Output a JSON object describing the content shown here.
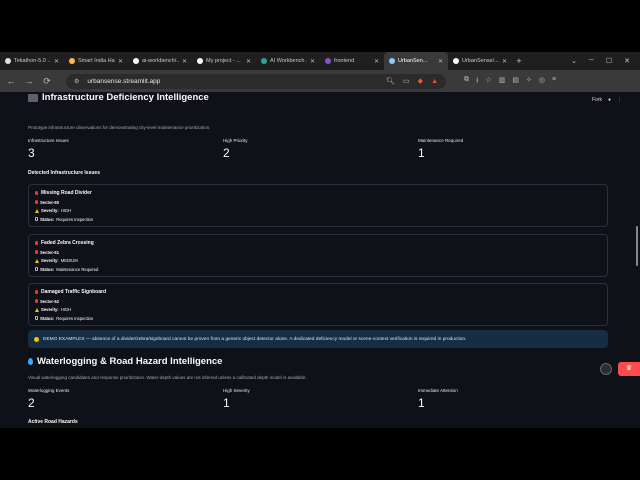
{
  "tabs": [
    {
      "label": "Tekathon-5.0 ..",
      "color": "#e0e0e0",
      "active": false
    },
    {
      "label": "Smart India Ha...",
      "color": "#ffb74d",
      "active": false
    },
    {
      "label": "ai-workbench/...",
      "color": "#ffffff",
      "active": false
    },
    {
      "label": "My project - ...",
      "color": "#ffffff",
      "active": false
    },
    {
      "label": "AI Workbench ...",
      "color": "#26a69a",
      "active": false
    },
    {
      "label": "frontend",
      "color": "#7e57c2",
      "active": false
    },
    {
      "label": "UrbanSen...",
      "color": "#90caf9",
      "active": true
    },
    {
      "label": "UrbanSense/...",
      "color": "#ffffff",
      "active": false
    }
  ],
  "browser": {
    "url": "urbansense.streamlit.app",
    "new_tab": "+",
    "back": "←",
    "forward": "→",
    "reload": "⟳",
    "min": "─",
    "max": "☐",
    "close": "✕",
    "dropdown": "⌄"
  },
  "header": {
    "fork_label": "Fork"
  },
  "infra": {
    "title": "Infrastructure Deficiency Intelligence",
    "subtitle": "Prototype infrastructure observations for demonstrating city-level maintenance prioritization.",
    "metrics": [
      {
        "label": "Infrastructure Issues",
        "value": "3"
      },
      {
        "label": "High Priority",
        "value": "2"
      },
      {
        "label": "Maintenance Required",
        "value": "1"
      }
    ],
    "detected_label": "Detected Infrastructure Issues",
    "issues": [
      {
        "title": "Missing Road Divider",
        "sector": "Sector-60",
        "severity_label": "Severity:",
        "severity": "HIGH",
        "status_label": "Status:",
        "status": "Requires Inspection"
      },
      {
        "title": "Faded Zebra Crossing",
        "sector": "Sector-61",
        "severity_label": "Severity:",
        "severity": "MEDIUM",
        "status_label": "Status:",
        "status": "Maintenance Required"
      },
      {
        "title": "Damaged Traffic Signboard",
        "sector": "Sector-62",
        "severity_label": "Severity:",
        "severity": "HIGH",
        "status_label": "Status:",
        "status": "Requires Inspection"
      }
    ],
    "info": "DEMO EXAMPLES — absence of a divider/zebra/signboard cannot be proven from a generic object detector alone. A dedicated deficiency model or scene-context verification is required in production."
  },
  "water": {
    "title": "Waterlogging & Road Hazard Intelligence",
    "subtitle": "Visual waterlogging candidates and response prioritization. Water-depth values are not inferred unless a calibrated depth model is available.",
    "metrics": [
      {
        "label": "Waterlogging Events",
        "value": "2"
      },
      {
        "label": "High Severity",
        "value": "1"
      },
      {
        "label": "Immediate Attention",
        "value": "1"
      }
    ],
    "active_label": "Active Road Hazards"
  },
  "colors": {
    "accent": "#ff4b4b",
    "background": "#0e1117",
    "info_bg": "#172d43"
  }
}
